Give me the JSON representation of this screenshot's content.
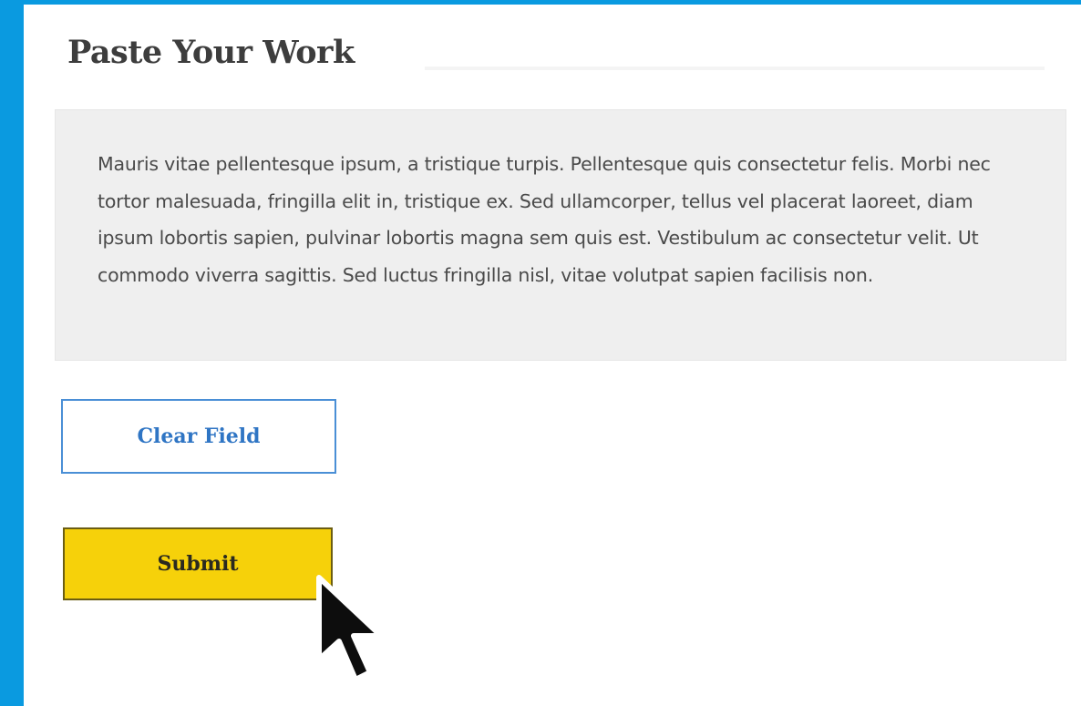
{
  "page": {
    "title": "Paste Your Work"
  },
  "editor": {
    "text": "Mauris vitae pellentesque ipsum, a tristique turpis. Pellentesque quis consectetur felis. Morbi nec tortor malesuada, fringilla elit in, tristique ex. Sed ullamcorper, tellus vel placerat laoreet, diam ipsum lobortis sapien, pulvinar lobortis magna sem quis est. Vestibulum ac consectetur velit. Ut commodo viverra sagittis. Sed luctus fringilla nisl, vitae volutpat sapien facilisis non."
  },
  "buttons": {
    "clear_label": "Clear Field",
    "submit_label": "Submit"
  },
  "cursor": {
    "icon": "mouse-pointer-icon"
  },
  "colors": {
    "frame": "#0a9ae0",
    "clear_border": "#4a8fd6",
    "clear_text": "#2f75c4",
    "submit_fill": "#f6d10a",
    "field_bg": "#efefef"
  }
}
